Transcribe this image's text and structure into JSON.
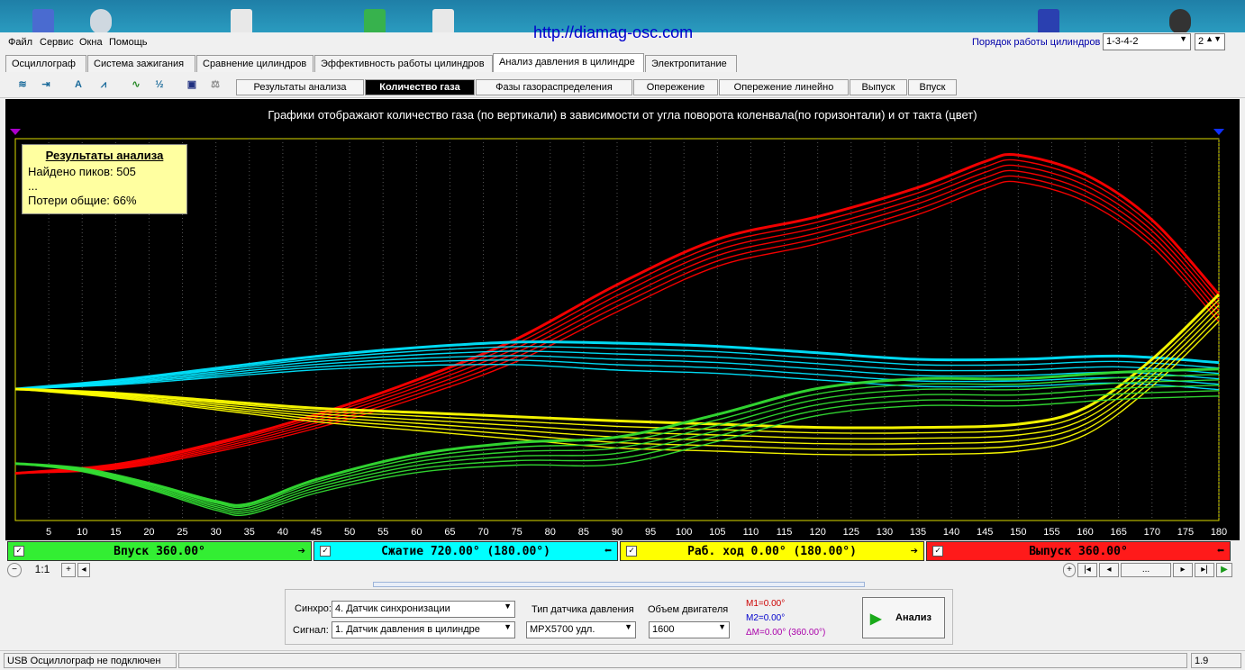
{
  "url": "http://diamag-osc.com",
  "menu": [
    "Файл",
    "Сервис",
    "Окна",
    "Помощь"
  ],
  "cylinder_order": {
    "label": "Порядок работы цилиндров",
    "value": "1-3-4-2",
    "count": "2"
  },
  "main_tabs": [
    "Осциллограф",
    "Система зажигания",
    "Сравнение цилиндров",
    "Эффективность работы цилиндров",
    "Анализ давления в цилиндре",
    "Электропитание"
  ],
  "toolbar_icons": [
    "oscilloscope-icon",
    "measure-icon",
    "auto-icon",
    "waveform-icon",
    "trend-icon",
    "algorithm-icon",
    "save-icon",
    "compare-icon"
  ],
  "sub_tabs": [
    "Результаты анализа",
    "Количество газа",
    "Фазы газораспределения",
    "Опережение",
    "Опережение линейно",
    "Выпуск",
    "Впуск"
  ],
  "chart_title": "Графики отображают количество газа (по вертикали) в зависимости от угла поворота коленвала(по горизонтали) и от такта (цвет)",
  "results": {
    "title": "Результаты анализа",
    "line1": "Найдено пиков: 505",
    "line2": "...",
    "line3": "Потери общие: 66%"
  },
  "chart_data": {
    "type": "line",
    "title": "Графики отображают количество газа (по вертикали) в зависимости от угла поворота коленвала(по горизонтали) и от такта (цвет)",
    "xlabel": "",
    "ylabel": "",
    "xlim": [
      0,
      180
    ],
    "x_ticks": [
      5,
      10,
      15,
      20,
      25,
      30,
      35,
      40,
      45,
      50,
      55,
      60,
      65,
      70,
      75,
      80,
      85,
      90,
      95,
      100,
      105,
      110,
      115,
      120,
      125,
      130,
      135,
      140,
      145,
      150,
      155,
      160,
      165,
      170,
      175,
      180
    ],
    "grid": "vertical dotted",
    "series": [
      {
        "name": "Впуск 360.00°",
        "color": "#ff0000",
        "x": [
          0,
          15,
          30,
          45,
          60,
          75,
          90,
          105,
          120,
          135,
          145,
          150,
          160,
          170,
          180
        ],
        "y": [
          0.04,
          0.06,
          0.12,
          0.2,
          0.3,
          0.42,
          0.58,
          0.72,
          0.79,
          0.88,
          0.96,
          0.98,
          0.92,
          0.78,
          0.55
        ]
      },
      {
        "name": "Сжатие 720.00° (180.00°)",
        "color": "#00e5ff",
        "x": [
          0,
          15,
          30,
          45,
          60,
          75,
          90,
          105,
          120,
          135,
          150,
          165,
          180
        ],
        "y": [
          0.3,
          0.32,
          0.35,
          0.38,
          0.4,
          0.41,
          0.4,
          0.39,
          0.37,
          0.35,
          0.35,
          0.36,
          0.34
        ]
      },
      {
        "name": "Раб. ход 0.00° (180.00°)",
        "color": "#ffff00",
        "x": [
          0,
          15,
          30,
          45,
          60,
          75,
          90,
          105,
          120,
          135,
          150,
          160,
          170,
          180
        ],
        "y": [
          0.3,
          0.28,
          0.25,
          0.22,
          0.2,
          0.18,
          0.16,
          0.15,
          0.14,
          0.14,
          0.15,
          0.2,
          0.35,
          0.55
        ]
      },
      {
        "name": "Выпуск 360.00°",
        "color": "#33dd33",
        "x": [
          0,
          10,
          20,
          30,
          35,
          45,
          60,
          75,
          90,
          105,
          120,
          135,
          150,
          165,
          180
        ],
        "y": [
          0.07,
          0.05,
          0.0,
          -0.06,
          -0.07,
          0.0,
          0.07,
          0.1,
          0.11,
          0.18,
          0.26,
          0.29,
          0.29,
          0.31,
          0.32
        ]
      }
    ]
  },
  "strokes": [
    {
      "label": "Впуск 360.00°",
      "color": "#33ee33"
    },
    {
      "label": "Сжатие 720.00° (180.00°)",
      "color": "#00ffff"
    },
    {
      "label": "Раб. ход 0.00° (180.00°)",
      "color": "#ffff00"
    },
    {
      "label": "Выпуск 360.00°",
      "color": "#ff1a1a"
    }
  ],
  "zoom": "1:1",
  "pager_dots": "...",
  "panel": {
    "sync_label": "Синхро:",
    "sync_value": "4. Датчик синхронизации",
    "signal_label": "Сигнал:",
    "signal_value": "1. Датчик давления в цилиндре",
    "sensor_label": "Тип датчика давления",
    "sensor_value": "MPX5700 удл.",
    "volume_label": "Объем двигателя",
    "volume_value": "1600",
    "m1": "M1=0.00°",
    "m2": "M2=0.00°",
    "dm": "ΔM=0.00° (360.00°)",
    "analyze": "Анализ"
  },
  "status": {
    "left": "USB Осциллограф не подключен",
    "right": "1.9"
  }
}
